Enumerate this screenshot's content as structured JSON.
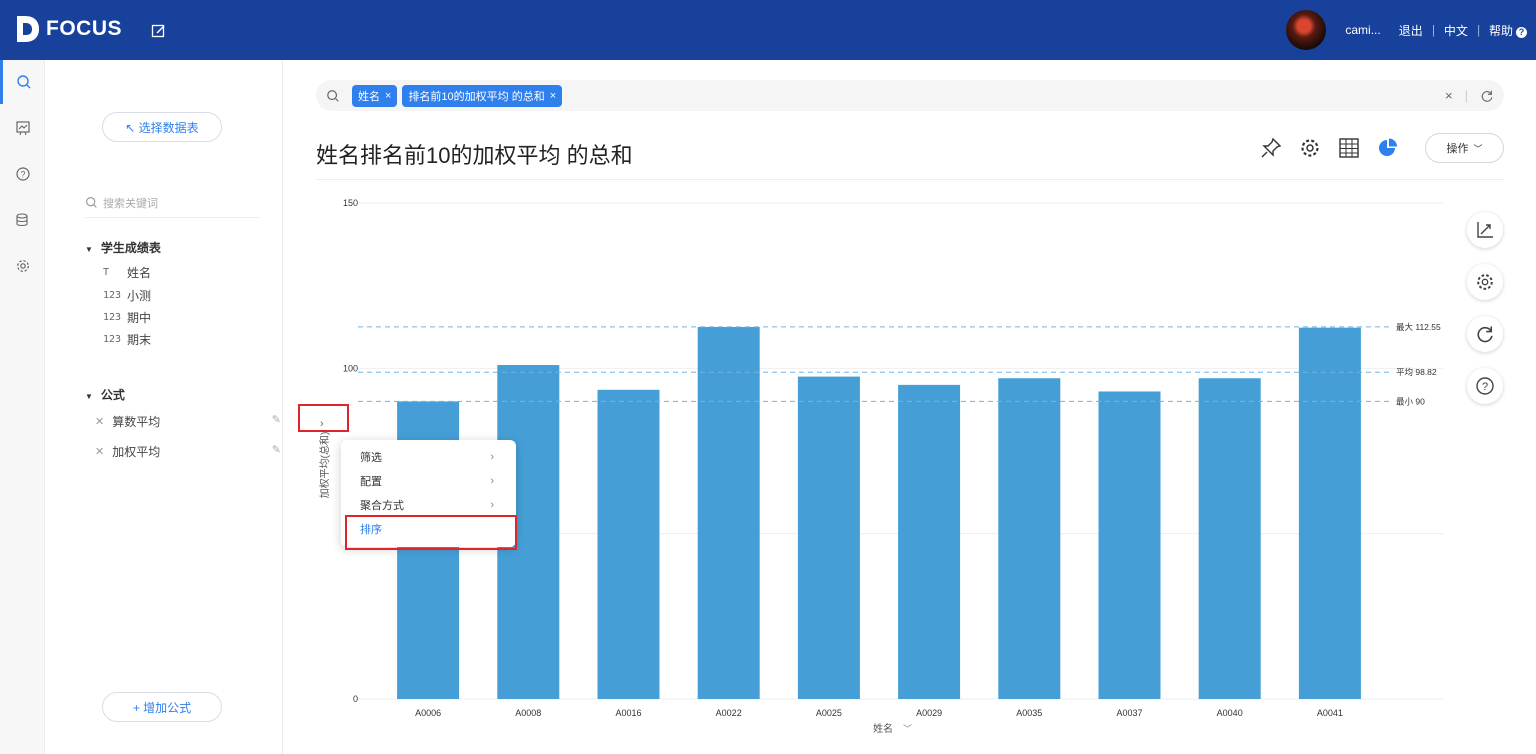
{
  "app": {
    "logo_text": "FOCUS"
  },
  "user": {
    "name": "cami...",
    "logout": "退出",
    "lang": "中文",
    "help": "帮助",
    "help_glyph": "?"
  },
  "sidebar": {
    "select_table": "↖ 选择数据表",
    "search_placeholder": "搜索关键词",
    "table_group": "学生成绩表",
    "fields": [
      {
        "type_icon": "T",
        "name": "姓名"
      },
      {
        "type_icon": "123",
        "name": "小测"
      },
      {
        "type_icon": "123",
        "name": "期中"
      },
      {
        "type_icon": "123",
        "name": "期末"
      }
    ],
    "formula_group": "公式",
    "formulas": [
      {
        "name": "算数平均"
      },
      {
        "name": "加权平均"
      }
    ],
    "add_formula": "+ 增加公式"
  },
  "search": {
    "tokens": [
      {
        "label": "姓名"
      },
      {
        "label": "排名前10的加权平均  的总和"
      }
    ],
    "close_glyph": "×"
  },
  "main": {
    "title": "姓名排名前10的加权平均 的总和",
    "operate_label": "操作",
    "collapse_glyph": "›"
  },
  "context_menu": {
    "items": [
      {
        "label": "筛选",
        "has_sub": true
      },
      {
        "label": "配置",
        "has_sub": true
      },
      {
        "label": "聚合方式",
        "has_sub": true
      },
      {
        "label": "排序",
        "has_sub": false
      }
    ],
    "sub_arrow": "›"
  },
  "chart_data": {
    "type": "bar",
    "categories": [
      "A0006",
      "A0008",
      "A0016",
      "A0022",
      "A0025",
      "A0029",
      "A0035",
      "A0037",
      "A0040",
      "A0041"
    ],
    "values": [
      90,
      101,
      93.5,
      112.5,
      97.5,
      95,
      97,
      93,
      97,
      112.3
    ],
    "xlabel": "姓名",
    "ylabel": "加权平均(总和)",
    "ylim": [
      0,
      150
    ],
    "yticks": [
      0,
      100,
      150
    ],
    "reference_lines": [
      {
        "label": "最大 112.55",
        "value": 112.55
      },
      {
        "label": "平均 98.82",
        "value": 98.82
      },
      {
        "label": "最小 90",
        "value": 90
      }
    ],
    "bar_color": "#459fd6",
    "grid": true
  }
}
